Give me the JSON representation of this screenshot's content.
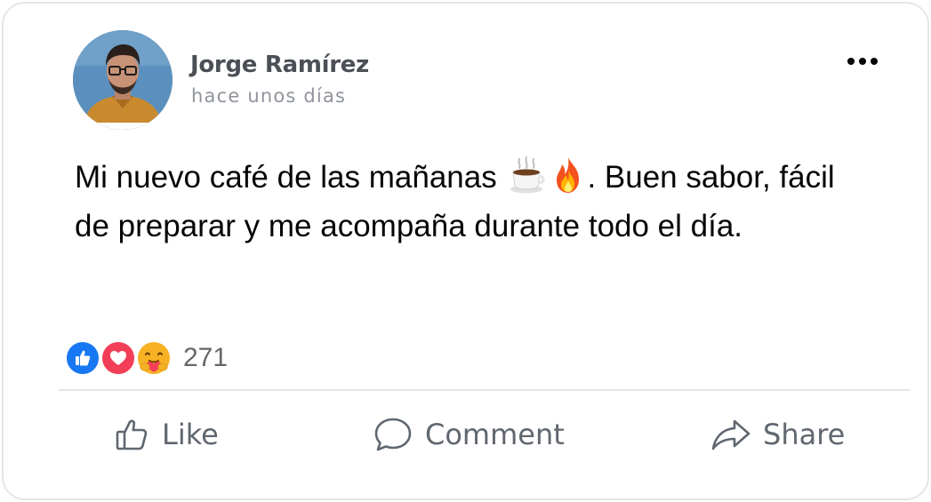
{
  "post": {
    "author": "Jorge Ramírez",
    "timestamp": "hace unos días",
    "text_part1": "Mi nuevo café de las mañanas ",
    "text_part2": ". Buen sabor, fácil de preparar y me acompaña durante todo el día.",
    "emojis": [
      "coffee-icon",
      "fire-icon"
    ]
  },
  "reactions": {
    "types": [
      "like-icon",
      "love-icon",
      "care-icon"
    ],
    "count": "271"
  },
  "actions": {
    "like_label": "Like",
    "comment_label": "Comment",
    "share_label": "Share"
  },
  "colors": {
    "like_blue": "#1877f2",
    "love_red": "#f33e58",
    "care_yellow": "#f7b125",
    "action_gray": "#606770"
  }
}
